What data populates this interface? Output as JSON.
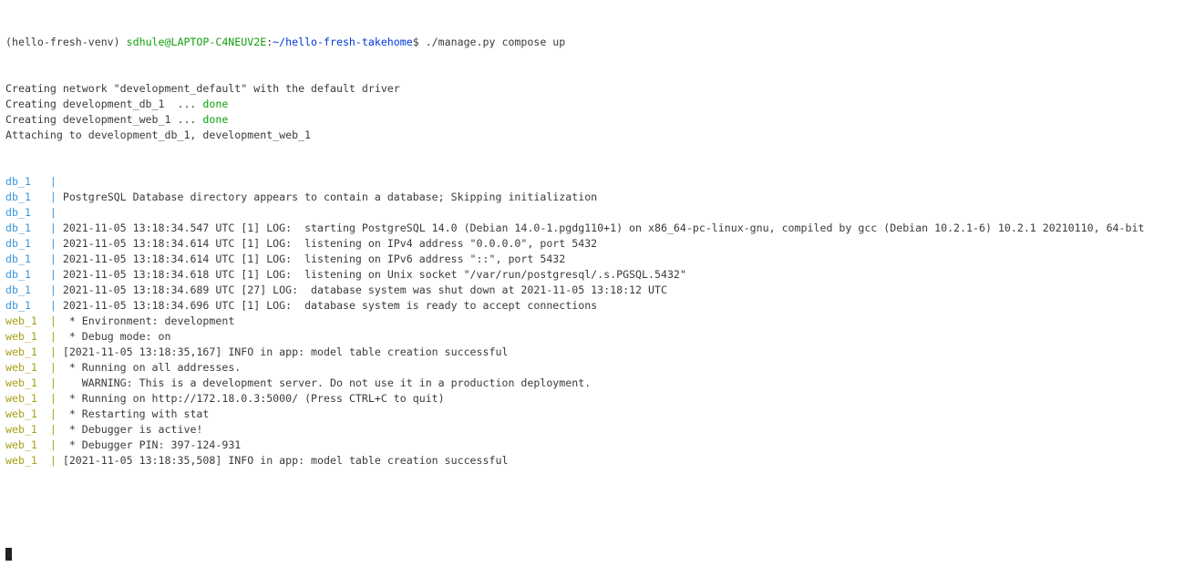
{
  "prompt": {
    "venv": "(hello-fresh-venv) ",
    "user_host": "sdhule@LAPTOP-C4NEUV2E",
    "colon": ":",
    "path": "~/hello-fresh-takehome",
    "dollar": "$",
    "command": " ./manage.py compose up"
  },
  "plain_lines": [
    {
      "text": "Creating network \"development_default\" with the default driver"
    },
    {
      "text": "Creating development_db_1  ... ",
      "status": "done"
    },
    {
      "text": "Creating development_web_1 ... ",
      "status": "done"
    },
    {
      "text": "Attaching to development_db_1, development_web_1"
    }
  ],
  "log_lines": [
    {
      "service": "db_1   ",
      "sep": "|",
      "text": ""
    },
    {
      "service": "db_1   ",
      "sep": "|",
      "text": " PostgreSQL Database directory appears to contain a database; Skipping initialization"
    },
    {
      "service": "db_1   ",
      "sep": "|",
      "text": ""
    },
    {
      "service": "db_1   ",
      "sep": "|",
      "text": " 2021-11-05 13:18:34.547 UTC [1] LOG:  starting PostgreSQL 14.0 (Debian 14.0-1.pgdg110+1) on x86_64-pc-linux-gnu, compiled by gcc (Debian 10.2.1-6) 10.2.1 20210110, 64-bit"
    },
    {
      "service": "db_1   ",
      "sep": "|",
      "text": " 2021-11-05 13:18:34.614 UTC [1] LOG:  listening on IPv4 address \"0.0.0.0\", port 5432"
    },
    {
      "service": "db_1   ",
      "sep": "|",
      "text": " 2021-11-05 13:18:34.614 UTC [1] LOG:  listening on IPv6 address \"::\", port 5432"
    },
    {
      "service": "db_1   ",
      "sep": "|",
      "text": " 2021-11-05 13:18:34.618 UTC [1] LOG:  listening on Unix socket \"/var/run/postgresql/.s.PGSQL.5432\""
    },
    {
      "service": "db_1   ",
      "sep": "|",
      "text": " 2021-11-05 13:18:34.689 UTC [27] LOG:  database system was shut down at 2021-11-05 13:18:12 UTC"
    },
    {
      "service": "db_1   ",
      "sep": "|",
      "text": " 2021-11-05 13:18:34.696 UTC [1] LOG:  database system is ready to accept connections"
    },
    {
      "service": "web_1  ",
      "sep": "|",
      "text": "  * Environment: development"
    },
    {
      "service": "web_1  ",
      "sep": "|",
      "text": "  * Debug mode: on"
    },
    {
      "service": "web_1  ",
      "sep": "|",
      "text": " [2021-11-05 13:18:35,167] INFO in app: model table creation successful"
    },
    {
      "service": "web_1  ",
      "sep": "|",
      "text": "  * Running on all addresses."
    },
    {
      "service": "web_1  ",
      "sep": "|",
      "text": "    WARNING: This is a development server. Do not use it in a production deployment."
    },
    {
      "service": "web_1  ",
      "sep": "|",
      "text": "  * Running on http://172.18.0.3:5000/ (Press CTRL+C to quit)"
    },
    {
      "service": "web_1  ",
      "sep": "|",
      "text": "  * Restarting with stat"
    },
    {
      "service": "web_1  ",
      "sep": "|",
      "text": "  * Debugger is active!"
    },
    {
      "service": "web_1  ",
      "sep": "|",
      "text": "  * Debugger PIN: 397-124-931"
    },
    {
      "service": "web_1  ",
      "sep": "|",
      "text": " [2021-11-05 13:18:35,508] INFO in app: model table creation successful"
    }
  ],
  "colors": {
    "prompt_user": "#13a10e",
    "prompt_path": "#0037da",
    "db_service": "#3a96dd",
    "web_service": "#a8a016",
    "text": "#3a3a3a",
    "done": "#13a10e"
  }
}
